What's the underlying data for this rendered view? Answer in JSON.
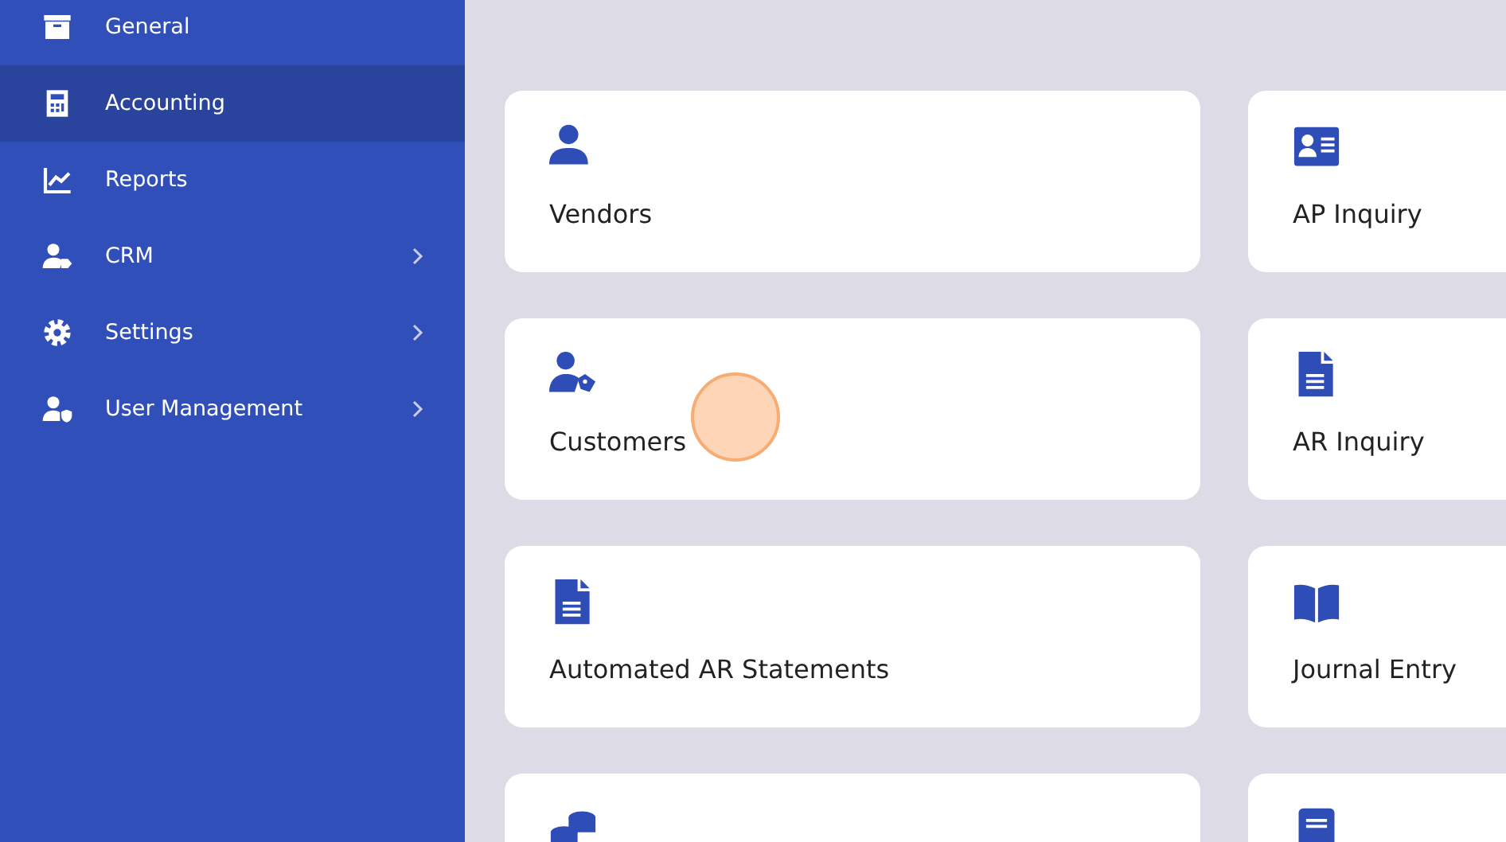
{
  "sidebar": {
    "items": [
      {
        "label": "General",
        "selected": false,
        "has_submenu": false
      },
      {
        "label": "Accounting",
        "selected": true,
        "has_submenu": false
      },
      {
        "label": "Reports",
        "selected": false,
        "has_submenu": false
      },
      {
        "label": "CRM",
        "selected": false,
        "has_submenu": true
      },
      {
        "label": "Settings",
        "selected": false,
        "has_submenu": true
      },
      {
        "label": "User Management",
        "selected": false,
        "has_submenu": true
      }
    ]
  },
  "cards": [
    {
      "label": "Vendors"
    },
    {
      "label": "AP Inquiry"
    },
    {
      "label": "Customers"
    },
    {
      "label": "AR Inquiry"
    },
    {
      "label": "Automated AR Statements"
    },
    {
      "label": "Journal Entry"
    }
  ]
}
